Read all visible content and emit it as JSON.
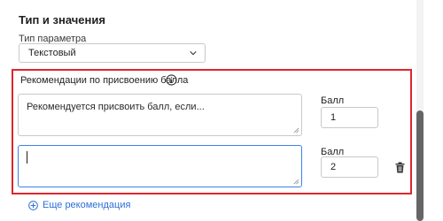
{
  "section": {
    "title": "Тип и значения",
    "param_type_label": "Тип параметра",
    "param_type_value": "Текстовый"
  },
  "recommendations": {
    "label": "Рекомендации по присвоению балла",
    "items": [
      {
        "text": "Рекомендуется присвоить балл, если...",
        "score_label": "Балл",
        "score": "1"
      },
      {
        "text": "",
        "score_label": "Балл",
        "score": "2"
      }
    ],
    "add_label": "Еще рекомендация"
  },
  "colors": {
    "highlight_border": "#e0262d",
    "focus_border": "#3b82e8",
    "link": "#2f6fd6"
  },
  "icons": [
    "chevron-down-icon",
    "info-icon",
    "trash-icon",
    "plus-circle-icon",
    "resize-grip-icon"
  ]
}
